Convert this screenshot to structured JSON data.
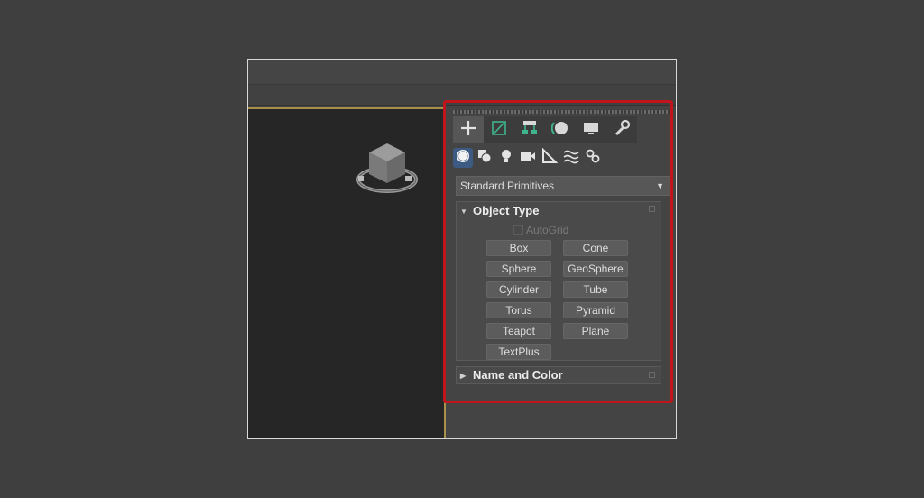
{
  "command_panel": {
    "main_tabs": [
      {
        "icon": "create-plus-icon",
        "active": true
      },
      {
        "icon": "modify-icon",
        "active": false
      },
      {
        "icon": "hierarchy-icon",
        "active": false
      },
      {
        "icon": "motion-icon",
        "active": false
      },
      {
        "icon": "display-icon",
        "active": false
      },
      {
        "icon": "utilities-wrench-icon",
        "active": false
      }
    ],
    "sub_tabs": [
      {
        "icon": "geometry-sphere-icon",
        "active": true
      },
      {
        "icon": "shapes-icon",
        "active": false
      },
      {
        "icon": "lights-icon",
        "active": false
      },
      {
        "icon": "cameras-icon",
        "active": false
      },
      {
        "icon": "helpers-icon",
        "active": false
      },
      {
        "icon": "space-warps-icon",
        "active": false
      },
      {
        "icon": "systems-icon",
        "active": false
      }
    ],
    "category_dropdown": {
      "value": "Standard Primitives"
    },
    "object_type": {
      "title": "Object Type",
      "autogrid_label": "AutoGrid",
      "buttons": [
        "Box",
        "Cone",
        "Sphere",
        "GeoSphere",
        "Cylinder",
        "Tube",
        "Torus",
        "Pyramid",
        "Teapot",
        "Plane",
        "TextPlus"
      ]
    },
    "name_and_color": {
      "title": "Name and Color"
    }
  },
  "colors": {
    "highlight_border": "#c2141b",
    "active_subtab": "#3c5a82",
    "viewport_border": "#a8904a"
  }
}
